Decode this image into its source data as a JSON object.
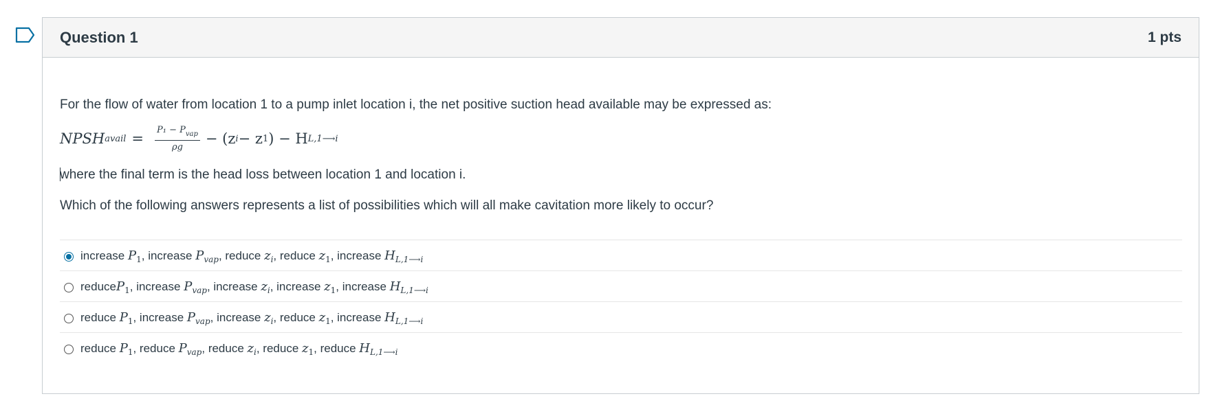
{
  "question": {
    "title": "Question 1",
    "points": "1 pts",
    "intro": "For the flow of water from location 1 to a pump inlet location i, the net positive suction head available may be expressed as:",
    "formula": {
      "lhs": "NPSH",
      "lhs_sub": "avail",
      "eq": "=",
      "numerator": "P₁ − P",
      "numerator_sub": "vap",
      "denominator": "ρg",
      "middle": "− (z",
      "middle_sub": "i",
      "middle2": " − z",
      "middle2_sub": "1",
      "middle3": ") − H",
      "end_sub": "L,1⟶i"
    },
    "explanation": "where the final term is the head loss between location 1 and location i.",
    "prompt": "Which of the following answers represents a list of possibilities which will all make cavitation more likely to occur?"
  },
  "answers": [
    {
      "selected": true,
      "parts": [
        "increase ",
        "P",
        "1",
        ", increase ",
        "P",
        "vap",
        ", reduce ",
        "z",
        "i",
        ", reduce ",
        "z",
        "1",
        ", increase ",
        "H",
        "L,1⟶i"
      ]
    },
    {
      "selected": false,
      "parts": [
        "reduce",
        "P",
        "1",
        ", increase ",
        "P",
        "vap",
        ", increase ",
        "z",
        "i",
        ", increase ",
        "z",
        "1",
        ", increase ",
        "H",
        "L,1⟶i"
      ]
    },
    {
      "selected": false,
      "parts": [
        "reduce ",
        "P",
        "1",
        ", increase ",
        "P",
        "vap",
        ", increase ",
        "z",
        "i",
        ", reduce ",
        "z",
        "1",
        ", increase ",
        "H",
        "L,1⟶i"
      ]
    },
    {
      "selected": false,
      "parts": [
        "reduce ",
        "P",
        "1",
        ", reduce ",
        "P",
        "vap",
        ", reduce ",
        "z",
        "i",
        ", reduce ",
        "z",
        "1",
        ", reduce ",
        "H",
        "L,1⟶i"
      ]
    }
  ],
  "colors": {
    "accent": "#0770a3",
    "text": "#2d3b45",
    "border": "#c7cdd1",
    "header_bg": "#f5f5f5"
  },
  "icons": {
    "flag": "bookmark-flag-icon"
  }
}
